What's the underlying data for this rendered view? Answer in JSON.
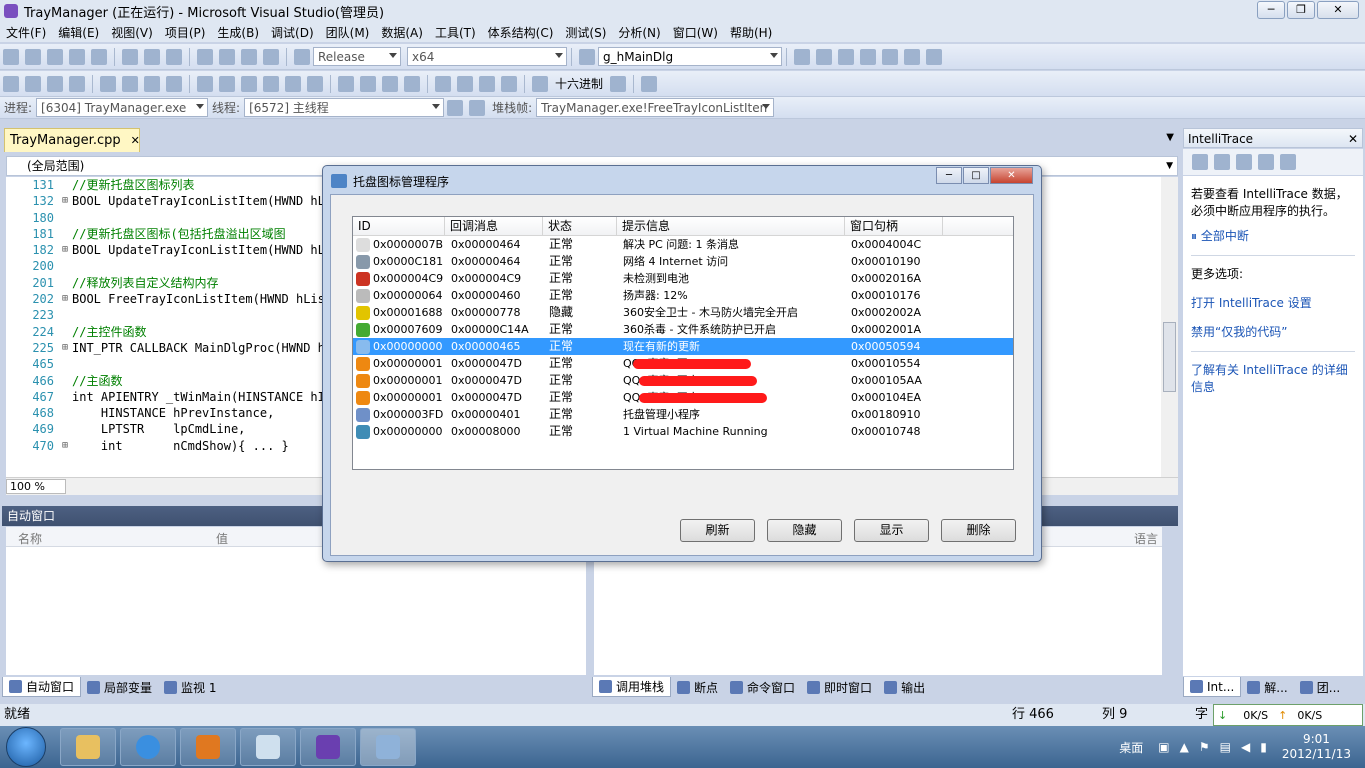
{
  "window": {
    "title": "TrayManager (正在运行) - Microsoft Visual Studio(管理员)"
  },
  "menu": [
    "文件(F)",
    "编辑(E)",
    "视图(V)",
    "项目(P)",
    "生成(B)",
    "调试(D)",
    "团队(M)",
    "数据(A)",
    "工具(T)",
    "体系结构(C)",
    "测试(S)",
    "分析(N)",
    "窗口(W)",
    "帮助(H)"
  ],
  "toolbar": {
    "config": "Release",
    "platform": "x64",
    "find": "g_hMainDlg",
    "hex_label": "十六进制",
    "process_label": "进程:",
    "process": "[6304] TrayManager.exe",
    "thread_label": "线程:",
    "thread": "[6572] 主线程",
    "stack_label": "堆栈帧:",
    "stack_frame": "TrayManager.exe!FreeTrayIconListIten"
  },
  "editor": {
    "tab": "TrayManager.cpp",
    "scope": "(全局范围)",
    "zoom": "100 %",
    "lines": [
      {
        "n": "131",
        "g": "",
        "code": "//更新托盘区图标列表",
        "type": "cmt"
      },
      {
        "n": "132",
        "g": "⊞",
        "code": "BOOL UpdateTrayIconListItem(HWND hL",
        "type": "code"
      },
      {
        "n": "180",
        "g": "",
        "code": "",
        "type": "code"
      },
      {
        "n": "181",
        "g": "",
        "code": "//更新托盘区图标(包括托盘溢出区域图",
        "type": "cmt"
      },
      {
        "n": "182",
        "g": "⊞",
        "code": "BOOL UpdateTrayIconListItem(HWND hL",
        "type": "code"
      },
      {
        "n": "200",
        "g": "",
        "code": "",
        "type": "code"
      },
      {
        "n": "201",
        "g": "",
        "code": "//释放列表自定义结构内存",
        "type": "cmt"
      },
      {
        "n": "202",
        "g": "⊞",
        "code": "BOOL FreeTrayIconListItem(HWND hLis",
        "type": "code"
      },
      {
        "n": "223",
        "g": "",
        "code": "",
        "type": "code"
      },
      {
        "n": "224",
        "g": "",
        "code": "//主控件函数",
        "type": "cmt"
      },
      {
        "n": "225",
        "g": "⊞",
        "code": "INT_PTR CALLBACK MainDlgProc(HWND h",
        "type": "code"
      },
      {
        "n": "465",
        "g": "",
        "code": "",
        "type": "code"
      },
      {
        "n": "466",
        "g": "",
        "code": "//主函数",
        "type": "cmt"
      },
      {
        "n": "467",
        "g": "",
        "code": "int APIENTRY _tWinMain(HINSTANCE hI",
        "type": "code"
      },
      {
        "n": "468",
        "g": "",
        "code": "    HINSTANCE hPrevInstance,",
        "type": "code"
      },
      {
        "n": "469",
        "g": "",
        "code": "    LPTSTR    lpCmdLine,",
        "type": "code"
      },
      {
        "n": "470",
        "g": "⊞",
        "code": "    int       nCmdShow){ ... }",
        "type": "code"
      }
    ]
  },
  "auto_window": {
    "title": "自动窗口",
    "col_name": "名称",
    "col_value": "值",
    "tabs": [
      "自动窗口",
      "局部变量",
      "监视 1"
    ]
  },
  "stack_window": {
    "col_lang": "语言",
    "tabs": [
      "调用堆栈",
      "断点",
      "命令窗口",
      "即时窗口",
      "输出"
    ]
  },
  "intellitrace": {
    "title": "IntelliTrace",
    "info": "若要查看 IntelliTrace 数据，必须中断应用程序的执行。",
    "break_all": "全部中断",
    "more_options": "更多选项:",
    "open_settings": "打开 IntelliTrace 设置",
    "disable_jmc": "禁用“仅我的代码”",
    "learn_more": "了解有关 IntelliTrace 的详细信息",
    "tabs": [
      "Int...",
      "解...",
      "团..."
    ]
  },
  "status": {
    "ready": "就绪",
    "line": "行 466",
    "col": "列 9",
    "char": "字",
    "down": "0K/S",
    "up": "0K/S"
  },
  "taskbar": {
    "desktop": "桌面",
    "time": "9:01",
    "date": "2012/11/13"
  },
  "dialog": {
    "title": "托盘图标管理程序",
    "columns": [
      "ID",
      "回调消息",
      "状态",
      "提示信息",
      "窗口句柄"
    ],
    "rows": [
      {
        "id": "0x0000007B",
        "msg": "0x00000464",
        "state": "正常",
        "tip": "解决 PC 问题: 1 条消息",
        "hwnd": "0x0004004C",
        "icon": "#dddddd"
      },
      {
        "id": "0x0000C181",
        "msg": "0x00000464",
        "state": "正常",
        "tip": "网络  4 Internet 访问",
        "hwnd": "0x00010190",
        "icon": "#8899aa"
      },
      {
        "id": "0x000004C9",
        "msg": "0x000004C9",
        "state": "正常",
        "tip": "未检测到电池",
        "hwnd": "0x0002016A",
        "icon": "#cc3322"
      },
      {
        "id": "0x00000064",
        "msg": "0x00000460",
        "state": "正常",
        "tip": "扬声器: 12%",
        "hwnd": "0x00010176",
        "icon": "#bbbbbb"
      },
      {
        "id": "0x00001688",
        "msg": "0x00000778",
        "state": "隐藏",
        "tip": "360安全卫士 - 木马防火墙完全开启",
        "hwnd": "0x0002002A",
        "icon": "#e2c400"
      },
      {
        "id": "0x00007609",
        "msg": "0x00000C14A",
        "state": "正常",
        "tip": "360杀毒 - 文件系统防护已开启",
        "hwnd": "0x0002001A",
        "icon": "#44aa33"
      },
      {
        "id": "0x00000000",
        "msg": "0x00000465",
        "state": "正常",
        "tip": "现在有新的更新",
        "hwnd": "0x00050594",
        "icon": "#88bbee"
      },
      {
        "id": "0x00000001",
        "msg": "0x0000047D",
        "state": "正常",
        "tip": "QQ: 声音: 开...",
        "hwnd": "0x00010554",
        "icon": "#ee8811"
      },
      {
        "id": "0x00000001",
        "msg": "0x0000047D",
        "state": "正常",
        "tip": "QQ: 声音: 开启...",
        "hwnd": "0x000105AA",
        "icon": "#ee8811"
      },
      {
        "id": "0x00000001",
        "msg": "0x0000047D",
        "state": "正常",
        "tip": "QQ: 声音: 开启...",
        "hwnd": "0x000104EA",
        "icon": "#ee8811"
      },
      {
        "id": "0x000003FD",
        "msg": "0x00000401",
        "state": "正常",
        "tip": "托盘管理小程序",
        "hwnd": "0x00180910",
        "icon": "#6f90c8"
      },
      {
        "id": "0x00000000",
        "msg": "0x00008000",
        "state": "正常",
        "tip": "1 Virtual Machine Running",
        "hwnd": "0x00010748",
        "icon": "#3f8cb5"
      }
    ],
    "buttons": {
      "refresh": "刷新",
      "hide": "隐藏",
      "show": "显示",
      "delete": "删除"
    }
  },
  "colors": {
    "selection": "#3399ff",
    "panel_title": "#4d6082",
    "editor_tab": "#fff7c4"
  }
}
